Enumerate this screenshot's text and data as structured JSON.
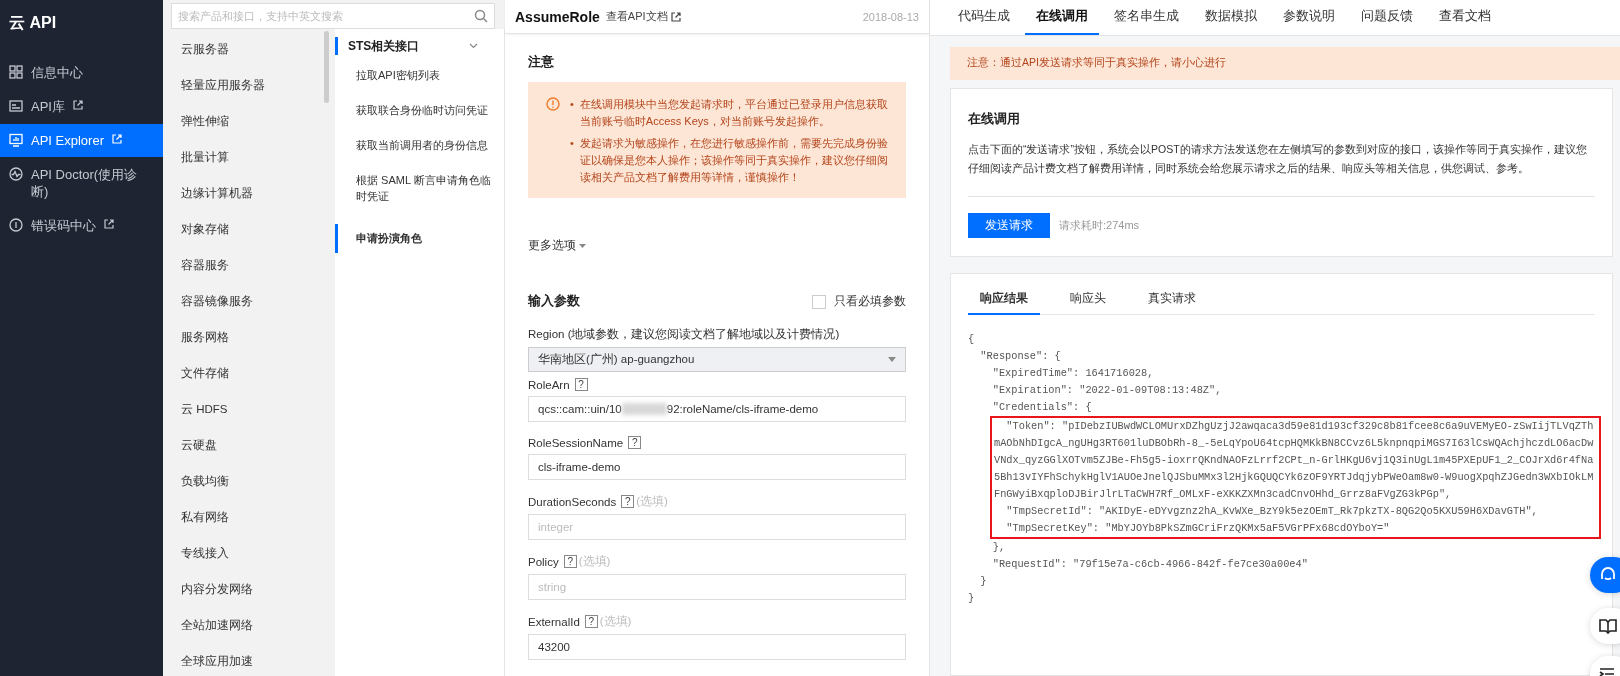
{
  "app": {
    "logo": "云 API"
  },
  "nav": [
    {
      "label": "信息中心",
      "external": false,
      "selected": false
    },
    {
      "label": "API库",
      "external": true,
      "selected": false
    },
    {
      "label": "API Explorer",
      "external": true,
      "selected": true
    },
    {
      "label": "API Doctor(使用诊断)",
      "external": false,
      "selected": false
    },
    {
      "label": "错误码中心",
      "external": true,
      "selected": false
    }
  ],
  "product_search": {
    "placeholder": "搜索产品和接口，支持中英文搜索"
  },
  "products": [
    "云服务器",
    "轻量应用服务器",
    "弹性伸缩",
    "批量计算",
    "边缘计算机器",
    "对象存储",
    "容器服务",
    "容器镜像服务",
    "服务网格",
    "文件存储",
    "云 HDFS",
    "云硬盘",
    "负载均衡",
    "私有网络",
    "专线接入",
    "内容分发网络",
    "全站加速网络",
    "全球应用加速"
  ],
  "api_group": {
    "title": "STS相关接口",
    "expanded": true,
    "items": [
      {
        "label": "拉取API密钥列表",
        "selected": false
      },
      {
        "label": "获取联合身份临时访问凭证",
        "selected": false
      },
      {
        "label": "获取当前调用者的身份信息",
        "selected": false
      },
      {
        "label": "根据 SAML 断言申请角色临时凭证",
        "selected": false
      },
      {
        "label": "申请扮演角色",
        "selected": true
      }
    ]
  },
  "form": {
    "title": "AssumeRole",
    "doc_link": "查看API文档",
    "date": "2018-08-13",
    "notice_title": "注意",
    "notices": [
      {
        "bullet": "•",
        "text": "在线调用模块中当您发起请求时，平台通过已登录用户信息获取当前账号临时Access Keys，对当前账号发起操作。"
      },
      {
        "bullet": "•",
        "text": "发起请求为敏感操作，在您进行敏感操作前，需要先完成身份验证以确保是您本人操作；该操作等同于真实操作，建议您仔细阅读相关产品文档了解费用等详情，谨慎操作！"
      }
    ],
    "more_options": "更多选项",
    "params_title": "输入参数",
    "required_only": {
      "label": "只看必填参数",
      "checked": false
    },
    "region": {
      "label": "Region",
      "hint": "(地域参数，建议您阅读文档了解地域以及计费情况)",
      "value": "华南地区(广州) ap-guangzhou"
    },
    "params": [
      {
        "name": "RoleArn",
        "help": "?",
        "value": "qcs::cam::uin/10",
        "redacted": true,
        "value_after": "92:roleName/cls-iframe-demo"
      },
      {
        "name": "RoleSessionName",
        "help": "?",
        "value": "cls-iframe-demo"
      },
      {
        "name": "DurationSeconds",
        "help": "?",
        "optional": "(选填)",
        "placeholder": "integer"
      },
      {
        "name": "Policy",
        "help": "?",
        "optional": "(选填)",
        "placeholder": "string"
      },
      {
        "name": "ExternalId",
        "help": "?",
        "optional": "(选填)",
        "value": "43200"
      }
    ]
  },
  "tabs": [
    {
      "label": "代码生成",
      "selected": false
    },
    {
      "label": "在线调用",
      "selected": true
    },
    {
      "label": "签名串生成",
      "selected": false
    },
    {
      "label": "数据模拟",
      "selected": false
    },
    {
      "label": "参数说明",
      "selected": false
    },
    {
      "label": "问题反馈",
      "selected": false
    },
    {
      "label": "查看文档",
      "selected": false
    }
  ],
  "warning": "注意：通过API发送请求等同于真实操作，请小心进行",
  "invoke": {
    "title": "在线调用",
    "description": "点击下面的“发送请求”按钮，系统会以POST的请求方法发送您在左侧填写的参数到对应的接口，该操作等同于真实操作，建议您仔细阅读产品计费文档了解费用详情，同时系统会给您展示请求之后的结果、响应头等相关信息，供您调试、参考。",
    "button": "发送请求",
    "elapsed": "请求耗时:274ms"
  },
  "result": {
    "tabs": [
      {
        "label": "响应结果",
        "selected": true
      },
      {
        "label": "响应头",
        "selected": false
      },
      {
        "label": "真实请求",
        "selected": false
      }
    ],
    "lines": [
      {
        "text": "{",
        "highlighted": false
      },
      {
        "text": "  \"Response\": {",
        "highlighted": false
      },
      {
        "text": "    \"ExpiredTime\": 1641716028,",
        "highlighted": false
      },
      {
        "text": "    \"Expiration\": \"2022-01-09T08:13:48Z\",",
        "highlighted": false
      },
      {
        "text": "    \"Credentials\": {",
        "highlighted": false
      },
      {
        "text": "      \"Token\": \"pIDebzIUBwdWCLOMUrxDZhgUzjJ2awqaca3d59e81d193cf329c8b81fcee8c6a9uVEMyEO-zSwIijTLVqZThmAObNhDIgcA_ngUHg3RT601luDBObRh-8_-5eLqYpoU64tcpHQMKkBN8CCvz6L5knpnqpiMGS7I63lCsWQAchjhczdLO6acDwVNdx_qyzGGlXOTvm5ZJBe-Fh5g5-ioxrrQKndNAOFzLrrf2CPt_n-GrlHKgU6vj1Q3inUgL1m45PXEpUF1_2_COJrXd6r4fNa5Bh13vIYFhSchykHglV1AUOeJnelQJSbuMMx3l2HjkGQUQCYk6zOF9YRTJdqjybPWeOam8w0-W9uogXpqhZJGedn3WXbIOkLMFnGWyiBxqploDJBirJlrLTaCWH7Rf_OMLxF-eXKKZXMn3cadCnvOHhd_Grrz8aFVgZG3kPGp\",",
        "highlighted": true
      },
      {
        "text": "      \"TmpSecretId\": \"AKIDyE-eDYvgznz2hA_KvWXe_BzY9k5ezOEmT_Rk7pkzTX-8QG2Qo5KXU59H6XDavGTH\",",
        "highlighted": true
      },
      {
        "text": "      \"TmpSecretKey\": \"MbYJOYb8PkSZmGCriFrzQKMx5aF5VGrPFx68cdOYboY=\"",
        "highlighted": true
      },
      {
        "text": "    },",
        "highlighted": false
      },
      {
        "text": "    \"RequestId\": \"79f15e7a-c6cb-4966-842f-fe7ce30a00e4\"",
        "highlighted": false
      },
      {
        "text": "  }",
        "highlighted": false
      },
      {
        "text": "}",
        "highlighted": false
      }
    ]
  }
}
